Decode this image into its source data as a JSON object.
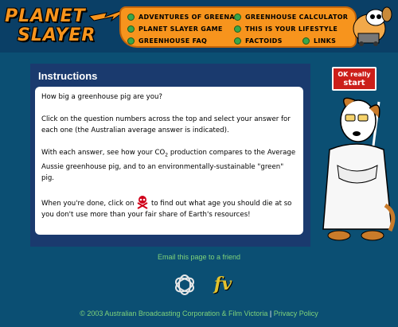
{
  "header": {
    "logo_line1": "PLANET",
    "logo_line2": "SLAYER",
    "nav": [
      {
        "label": "ADVENTURES OF GREENA"
      },
      {
        "label": "GREENHOUSE CALCULATOR"
      },
      {
        "label": "PLANET SLAYER GAME"
      },
      {
        "label": "THIS IS YOUR LIFESTYLE"
      },
      {
        "label": "GREENHOUSE FAQ"
      },
      {
        "label": "FACTOIDS"
      },
      {
        "label": "LINKS"
      }
    ]
  },
  "panel": {
    "title": "Instructions",
    "p1": "How big a greenhouse pig are you?",
    "p2": "Click on the question numbers across the top and select your answer for each one (the Australian average answer is indicated).",
    "p3a": "With each answer, see how your CO",
    "p3sub": "2",
    "p3b": " production compares to the Average Aussie greenhouse pig, and to an environmentally-sustainable \"green\" pig.",
    "p4a": "When you're done, click on ",
    "p4b": " to find out what age you should die at so you don't use more than your fair share of Earth's resources!"
  },
  "start_button": {
    "line1": "OK really",
    "line2": "start"
  },
  "footer": {
    "email": "Email this page to a friend",
    "copyright": "© 2003 Australian Broadcasting Corporation & Film Victoria",
    "separator": "|",
    "privacy": "Privacy Policy",
    "fv_logo_text": "fv"
  },
  "colors": {
    "background": "#0b4f73",
    "nav_bg": "#f7941d",
    "start_button": "#cc1f1a",
    "footer_text": "#7fd37a"
  },
  "icons": {
    "nav_bullet": "green-dot-icon",
    "finish": "skull-crossbones-icon",
    "abc_logo": "abc-logo",
    "fv_logo": "film-victoria-logo"
  }
}
